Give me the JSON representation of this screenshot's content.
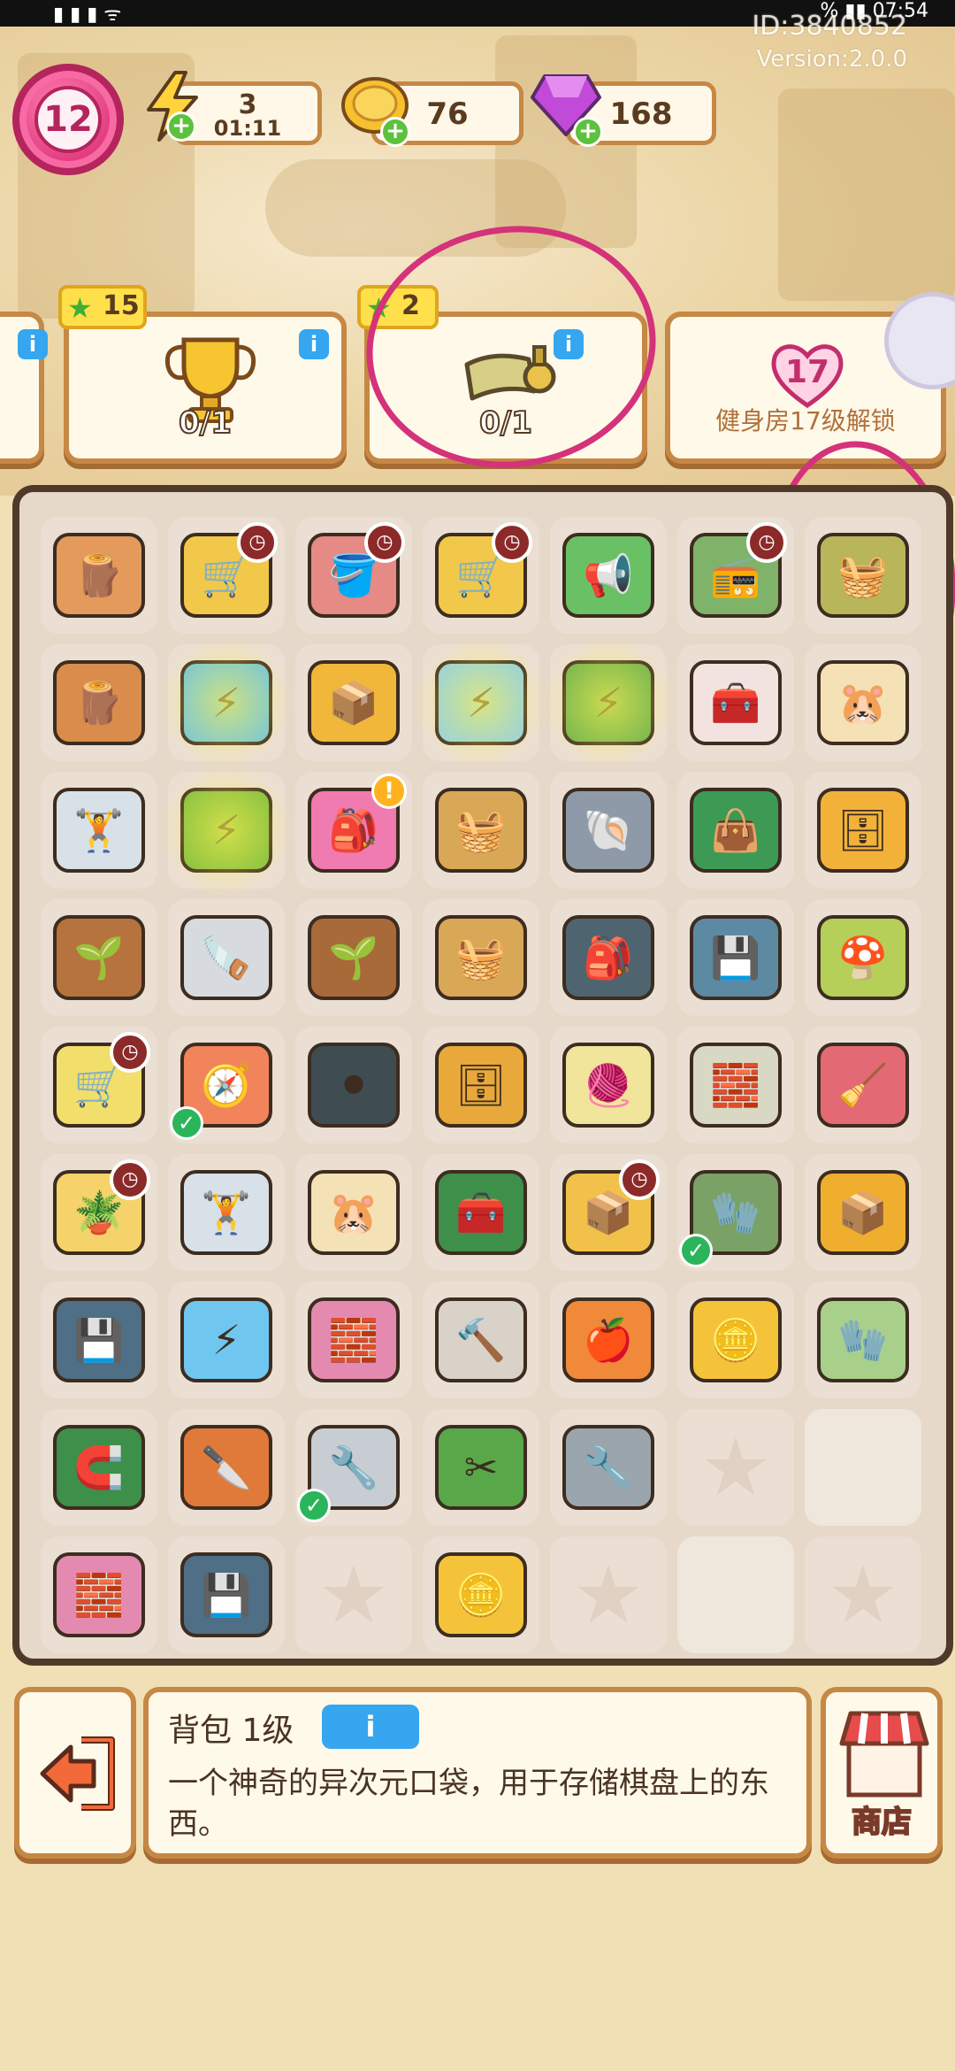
{
  "status_bar": {
    "left": "▮ ▮ ▮ ᯤ",
    "right": "%  ▮▮  07:54"
  },
  "account": {
    "id": "ID:3840852",
    "version": "Version:2.0.0"
  },
  "player": {
    "level": "12"
  },
  "resources": {
    "energy": {
      "value": "3",
      "timer": "01:11",
      "icon": "lightning-icon"
    },
    "coins": {
      "value": "76",
      "icon": "coin-icon"
    },
    "gems": {
      "value": "168",
      "icon": "gem-icon"
    }
  },
  "goals": [
    {
      "stars": "15",
      "progress": "0/1",
      "icon": "trophy-icon"
    },
    {
      "stars": "2",
      "progress": "0/1",
      "icon": "scroll-icon"
    },
    {
      "heart_level": "17",
      "unlock_text": "健身房17级解锁"
    }
  ],
  "info_label": "i",
  "board": {
    "cells": [
      {
        "icon": "🪵",
        "bg": "#e39a5a"
      },
      {
        "icon": "🛒",
        "bg": "#f1c84a",
        "timer": true
      },
      {
        "icon": "🪣",
        "bg": "#e58a84",
        "timer": true
      },
      {
        "icon": "🛒",
        "bg": "#f1c84a",
        "timer": true
      },
      {
        "icon": "📢",
        "bg": "#6ac165"
      },
      {
        "icon": "📻",
        "bg": "#7fb36a",
        "timer": true
      },
      {
        "icon": "🧺",
        "bg": "#b9b55a"
      },
      {
        "icon": "🪵",
        "bg": "#d98c4b"
      },
      {
        "icon": "⚡",
        "bg": "#6fc4e0",
        "glow": true
      },
      {
        "icon": "📦",
        "bg": "#f0b73a"
      },
      {
        "icon": "⚡",
        "bg": "#8fd0e8",
        "glow": true
      },
      {
        "icon": "⚡",
        "bg": "#6cb24f",
        "glow": true
      },
      {
        "icon": "🧰",
        "bg": "#f3e3e0"
      },
      {
        "icon": "🐹",
        "bg": "#f4e1b6"
      },
      {
        "icon": "🏋",
        "bg": "#d8e0e8"
      },
      {
        "icon": "⚡",
        "bg": "#7fbe3f",
        "glow": true
      },
      {
        "icon": "🎒",
        "bg": "#f07bb0",
        "alert": true
      },
      {
        "icon": "🧺",
        "bg": "#d8a857"
      },
      {
        "icon": "🐚",
        "bg": "#8f9aa9"
      },
      {
        "icon": "👜",
        "bg": "#3d9a55"
      },
      {
        "icon": "🗄",
        "bg": "#f2b23a"
      },
      {
        "icon": "🌱",
        "bg": "#b7733e"
      },
      {
        "icon": "🪚",
        "bg": "#d7dbdf"
      },
      {
        "icon": "🌱",
        "bg": "#a86a38"
      },
      {
        "icon": "🧺",
        "bg": "#d8a857"
      },
      {
        "icon": "🎒",
        "bg": "#4e6570"
      },
      {
        "icon": "💾",
        "bg": "#5d8aa3"
      },
      {
        "icon": "🍄",
        "bg": "#b5cf58"
      },
      {
        "icon": "🛒",
        "bg": "#f2de6a",
        "timer": true
      },
      {
        "icon": "🧭",
        "bg": "#f1845a",
        "check": true
      },
      {
        "icon": "⚫",
        "bg": "#3f4d52"
      },
      {
        "icon": "🗄",
        "bg": "#e8a93a"
      },
      {
        "icon": "🧶",
        "bg": "#f0e59a"
      },
      {
        "icon": "🧱",
        "bg": "#d9d8c5"
      },
      {
        "icon": "🧹",
        "bg": "#e36a74"
      },
      {
        "icon": "🪴",
        "bg": "#f5d36a",
        "timer": true
      },
      {
        "icon": "🏋",
        "bg": "#d8e0e8"
      },
      {
        "icon": "🐹",
        "bg": "#f4e1b6"
      },
      {
        "icon": "🧰",
        "bg": "#3d8f4a"
      },
      {
        "icon": "📦",
        "bg": "#f2c14a",
        "timer": true
      },
      {
        "icon": "🧤",
        "bg": "#7aa267",
        "check": true
      },
      {
        "icon": "📦",
        "bg": "#f0ae2e"
      },
      {
        "icon": "💾",
        "bg": "#4e6f85"
      },
      {
        "icon": "⚡",
        "bg": "#6fc7f0"
      },
      {
        "icon": "🧱",
        "bg": "#e48ab0"
      },
      {
        "icon": "🔨",
        "bg": "#d8d2c8"
      },
      {
        "icon": "🍎",
        "bg": "#f08a3a"
      },
      {
        "icon": "🪙",
        "bg": "#f5c33a"
      },
      {
        "icon": "🧤",
        "bg": "#a8d08a"
      },
      {
        "icon": "🧲",
        "bg": "#3d8f4a"
      },
      {
        "icon": "🔪",
        "bg": "#e07a3a"
      },
      {
        "icon": "🔧",
        "bg": "#c7cdd2",
        "check": true
      },
      {
        "icon": "✂",
        "bg": "#58a84a"
      },
      {
        "icon": "🔧",
        "bg": "#9aa5ad"
      },
      {
        "empty": true
      },
      {
        "blank": true
      },
      {
        "icon": "🧱",
        "bg": "#e48ab0"
      },
      {
        "icon": "💾",
        "bg": "#4e6f85"
      },
      {
        "empty": true
      },
      {
        "icon": "🪙",
        "bg": "#f5c33a"
      },
      {
        "empty": true
      },
      {
        "blank": true
      },
      {
        "empty": true
      }
    ]
  },
  "selected_item": {
    "title": "背包 1级",
    "description": "一个神奇的异次元口袋，用于存储棋盘上的东西。"
  },
  "buttons": {
    "exit_icon": "exit-icon",
    "shop_label": "商店"
  },
  "colors": {
    "annotation": "#d4327a",
    "board_border": "#4f3a2a",
    "panel_border": "#c68845"
  }
}
